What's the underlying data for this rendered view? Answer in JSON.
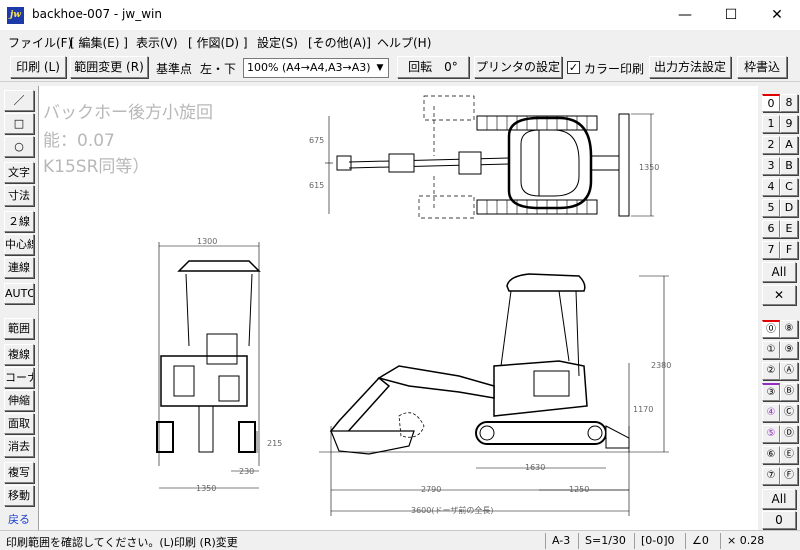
{
  "window": {
    "title": "backhoe-007 - jw_win",
    "app_icon_text": "jw",
    "minimize": "—",
    "maximize": "☐",
    "close": "✕"
  },
  "menu": [
    "ファイル(F)",
    "[ 編集(E) ]",
    "表示(V)",
    "[ 作図(D) ]",
    "設定(S)",
    "[その他(A)]",
    "ヘルプ(H)"
  ],
  "toolbar": {
    "print_button": "印刷 (L)",
    "range_change_button": "範囲変更 (R)",
    "base_point_label": "基準点",
    "base_point_value": "左・下",
    "scale_select": "100% (A4→A4,A3→A3)",
    "rotate_button": "回転　0°",
    "printer_settings_button": "プリンタの設定",
    "color_print_label": "カラー印刷",
    "color_print_checked": true,
    "output_method_button": "出力方法設定",
    "frame_button": "枠書込"
  },
  "left_tools": [
    "／",
    "□",
    "○",
    "文字",
    "寸法",
    "２線",
    "中心線",
    "連線",
    "AUTO",
    "範囲",
    "複線",
    "コーナー",
    "伸縮",
    "面取",
    "消去",
    "複写",
    "移動",
    "戻る"
  ],
  "layer_groups_top": [
    "0",
    "8",
    "1",
    "9",
    "2",
    "A",
    "3",
    "B",
    "4",
    "C",
    "5",
    "D",
    "6",
    "E",
    "7",
    "F"
  ],
  "layer_groups_top_all": "All",
  "layer_groups_top_x": "✕",
  "layers_bottom": [
    "⓪",
    "⑧",
    "①",
    "⑨",
    "②",
    "Ⓐ",
    "③",
    "Ⓑ",
    "④",
    "Ⓒ",
    "⑤",
    "Ⓓ",
    "⑥",
    "Ⓔ",
    "⑦",
    "Ⓕ"
  ],
  "layers_bottom_all": "All",
  "layers_bottom_zero": "0",
  "canvas": {
    "text_line1": "バックホー後方小旋回",
    "text_line2": "能：0.07",
    "text_line3": "K15SR同等）",
    "dims": {
      "d675": "675",
      "d615": "615",
      "d1350_right": "1350",
      "d1300": "1300",
      "d215": "215",
      "d230": "230",
      "d1350_bottom": "1350",
      "d2380": "2380",
      "d1170": "1170",
      "d1630": "1630",
      "d2790": "2790",
      "d1250": "1250",
      "d3600": "3600(ドーザ前の全長)"
    }
  },
  "status": {
    "message": "印刷範囲を確認してください。(L)印刷 (R)変更",
    "paper": "A-3",
    "scale": "S=1/30",
    "layer": "[0-0]0",
    "angle": "∠0",
    "zoom": "× 0.28"
  }
}
